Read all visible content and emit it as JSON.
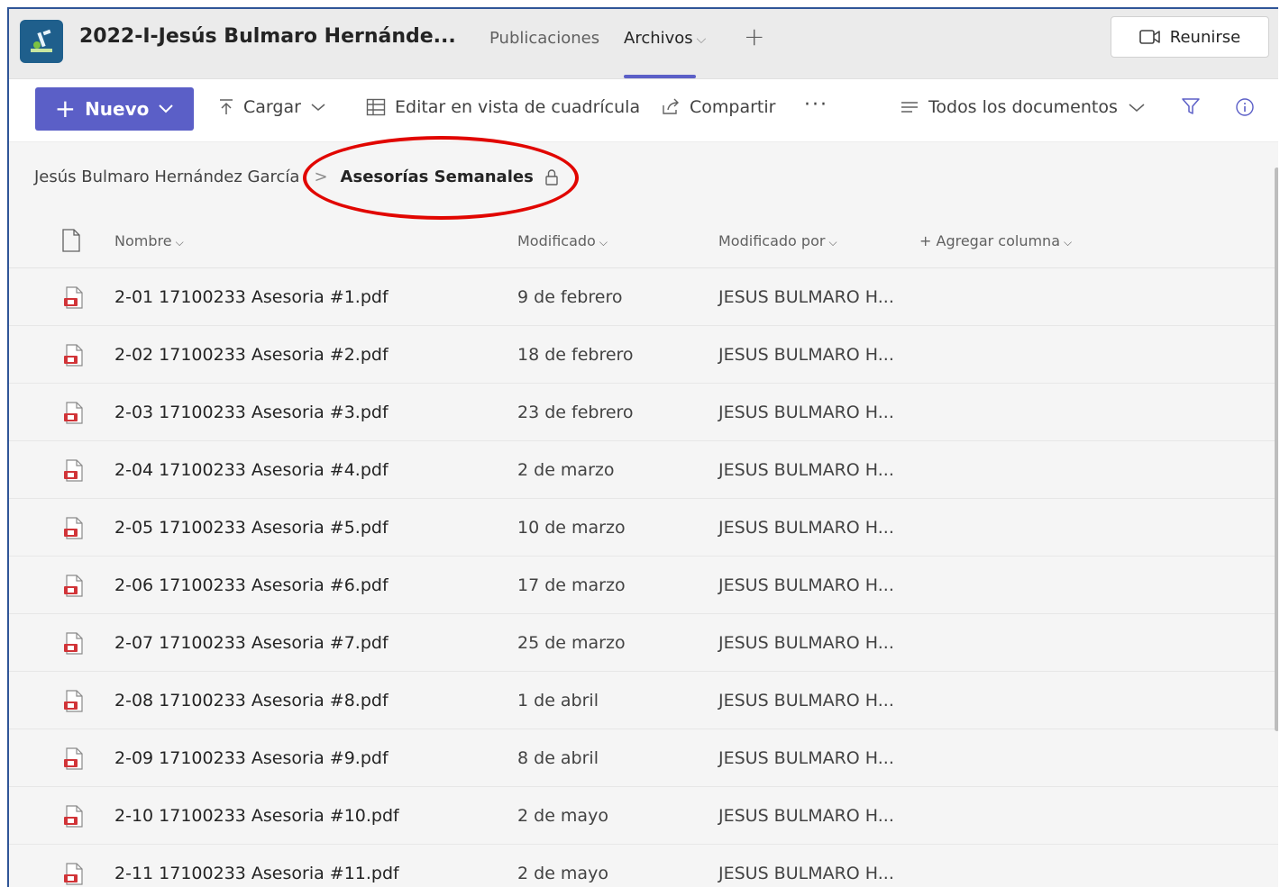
{
  "team": {
    "title": "2022-I-Jesús Bulmaro Hernánde..."
  },
  "tabs": [
    {
      "label": "Publicaciones"
    },
    {
      "label": "Archivos",
      "active": true
    }
  ],
  "meet_button": {
    "label": "Reunirse"
  },
  "toolbar": {
    "new_label": "Nuevo",
    "upload_label": "Cargar",
    "grid_label": "Editar en vista de cuadrícula",
    "share_label": "Compartir",
    "more_label": "···",
    "views_label": "Todos los documentos"
  },
  "breadcrumb": {
    "root": "Jesús Bulmaro Hernández García",
    "current": "Asesorías Semanales"
  },
  "columns": {
    "name": "Nombre",
    "modified": "Modificado",
    "modified_by": "Modificado por",
    "add_column": "+ Agregar columna"
  },
  "files": [
    {
      "name": "2-01 17100233 Asesoria #1.pdf",
      "modified": "9 de febrero",
      "modified_by": "JESUS BULMARO H..."
    },
    {
      "name": "2-02 17100233 Asesoria #2.pdf",
      "modified": "18 de febrero",
      "modified_by": "JESUS BULMARO H..."
    },
    {
      "name": "2-03 17100233 Asesoria #3.pdf",
      "modified": "23 de febrero",
      "modified_by": "JESUS BULMARO H..."
    },
    {
      "name": "2-04 17100233 Asesoria #4.pdf",
      "modified": "2 de marzo",
      "modified_by": "JESUS BULMARO H..."
    },
    {
      "name": "2-05 17100233 Asesoria #5.pdf",
      "modified": "10 de marzo",
      "modified_by": "JESUS BULMARO H..."
    },
    {
      "name": "2-06 17100233 Asesoria #6.pdf",
      "modified": "17 de marzo",
      "modified_by": "JESUS BULMARO H..."
    },
    {
      "name": "2-07 17100233 Asesoria #7.pdf",
      "modified": "25 de marzo",
      "modified_by": "JESUS BULMARO H..."
    },
    {
      "name": "2-08 17100233 Asesoria #8.pdf",
      "modified": "1 de abril",
      "modified_by": "JESUS BULMARO H..."
    },
    {
      "name": "2-09 17100233 Asesoria #9.pdf",
      "modified": "8 de abril",
      "modified_by": "JESUS BULMARO H..."
    },
    {
      "name": "2-10 17100233 Asesoria #10.pdf",
      "modified": "2 de mayo",
      "modified_by": "JESUS BULMARO H..."
    },
    {
      "name": "2-11 17100233 Asesoria #11.pdf",
      "modified": "2 de mayo",
      "modified_by": "JESUS BULMARO H..."
    }
  ],
  "colors": {
    "accent": "#5b5fc7",
    "highlight_ellipse": "#e10600",
    "pdf_icon": "#d13438"
  }
}
